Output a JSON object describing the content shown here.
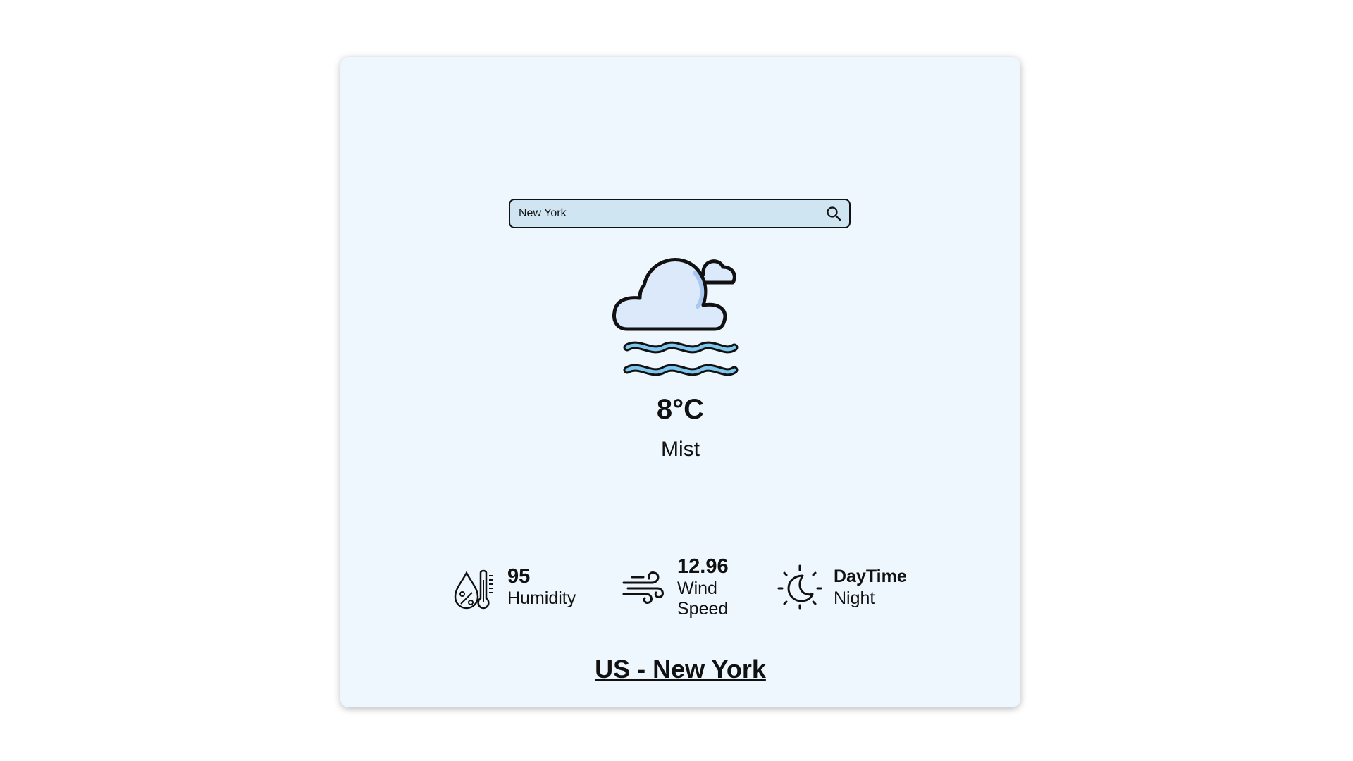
{
  "search": {
    "value": "New York",
    "icon": "search-icon"
  },
  "weather": {
    "icon": "mist-cloud-icon",
    "temperature": "8°C",
    "description": "Mist"
  },
  "stats": {
    "humidity": {
      "icon": "humidity-thermometer-icon",
      "value": "95",
      "label": "Humidity"
    },
    "wind": {
      "icon": "wind-icon",
      "value": "12.96",
      "label": "Wind Speed"
    },
    "daytime": {
      "icon": "moon-night-icon",
      "value": "DayTime",
      "label": "Night"
    }
  },
  "location": "US - New York",
  "colors": {
    "card_bg": "#eef6fe",
    "search_bg": "#cfe5f2",
    "cloud_fill": "#dbe9fb",
    "mist_wave": "#7ec8f0",
    "text": "#111111"
  }
}
